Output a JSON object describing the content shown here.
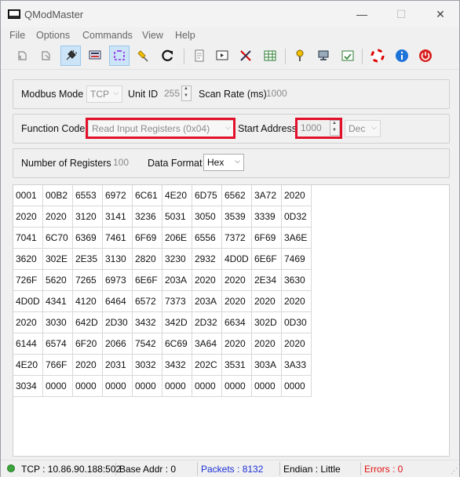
{
  "window": {
    "title": "QModMaster",
    "minimize": "—",
    "maximize": "☐",
    "close": "✕"
  },
  "menu": [
    "File",
    "Options",
    "Commands",
    "View",
    "Help"
  ],
  "toolbar_icons": [
    "connect-icon",
    "disconnect-icon",
    "plug-icon",
    "serial-settings-icon",
    "tcp-settings-icon",
    "clear-icon",
    "reset-icon",
    "log-icon",
    "bus-monitor-icon",
    "tools-icon",
    "table-icon",
    "settings-icon",
    "modbus-adapter-icon",
    "scan-icon",
    "help-icon",
    "info-icon",
    "exit-icon"
  ],
  "row1": {
    "modbus_mode_label": "Modbus Mode",
    "modbus_mode_value": "TCP",
    "unit_id_label": "Unit ID",
    "unit_id_value": "255",
    "scan_rate_label": "Scan Rate (ms)",
    "scan_rate_value": "1000"
  },
  "row2": {
    "function_code_label": "Function Code",
    "function_code_value": "Read Input Registers (0x04)",
    "start_address_label": "Start Address",
    "start_address_value": "1000",
    "address_format_value": "Dec"
  },
  "row3": {
    "num_registers_label": "Number of Registers",
    "num_registers_value": "100",
    "data_format_label": "Data Format",
    "data_format_value": "Hex"
  },
  "registers": [
    [
      "0001",
      "00B2",
      "6553",
      "6972",
      "6C61",
      "4E20",
      "6D75",
      "6562",
      "3A72",
      "2020"
    ],
    [
      "2020",
      "2020",
      "3120",
      "3141",
      "3236",
      "5031",
      "3050",
      "3539",
      "3339",
      "0D32"
    ],
    [
      "7041",
      "6C70",
      "6369",
      "7461",
      "6F69",
      "206E",
      "6556",
      "7372",
      "6F69",
      "3A6E"
    ],
    [
      "3620",
      "302E",
      "2E35",
      "3130",
      "2820",
      "3230",
      "2932",
      "4D0D",
      "6E6F",
      "7469"
    ],
    [
      "726F",
      "5620",
      "7265",
      "6973",
      "6E6F",
      "203A",
      "2020",
      "2020",
      "2E34",
      "3630"
    ],
    [
      "4D0D",
      "4341",
      "4120",
      "6464",
      "6572",
      "7373",
      "203A",
      "2020",
      "2020",
      "2020"
    ],
    [
      "2020",
      "3030",
      "642D",
      "2D30",
      "3432",
      "342D",
      "2D32",
      "6634",
      "302D",
      "0D30"
    ],
    [
      "6144",
      "6574",
      "6F20",
      "2066",
      "7542",
      "6C69",
      "3A64",
      "2020",
      "2020",
      "2020"
    ],
    [
      "4E20",
      "766F",
      "2020",
      "2031",
      "3032",
      "3432",
      "202C",
      "3531",
      "303A",
      "3A33"
    ],
    [
      "3034",
      "0000",
      "0000",
      "0000",
      "0000",
      "0000",
      "0000",
      "0000",
      "0000",
      "0000"
    ]
  ],
  "status": {
    "connection": "TCP : 10.86.90.188:502",
    "base_addr": "Base Addr : 0",
    "packets": "Packets : 8132",
    "endian": "Endian : Little",
    "errors": "Errors : 0"
  },
  "colors": {
    "packets": "#1a2fd4",
    "errors": "#e01010",
    "highlight": "#e3102b"
  }
}
